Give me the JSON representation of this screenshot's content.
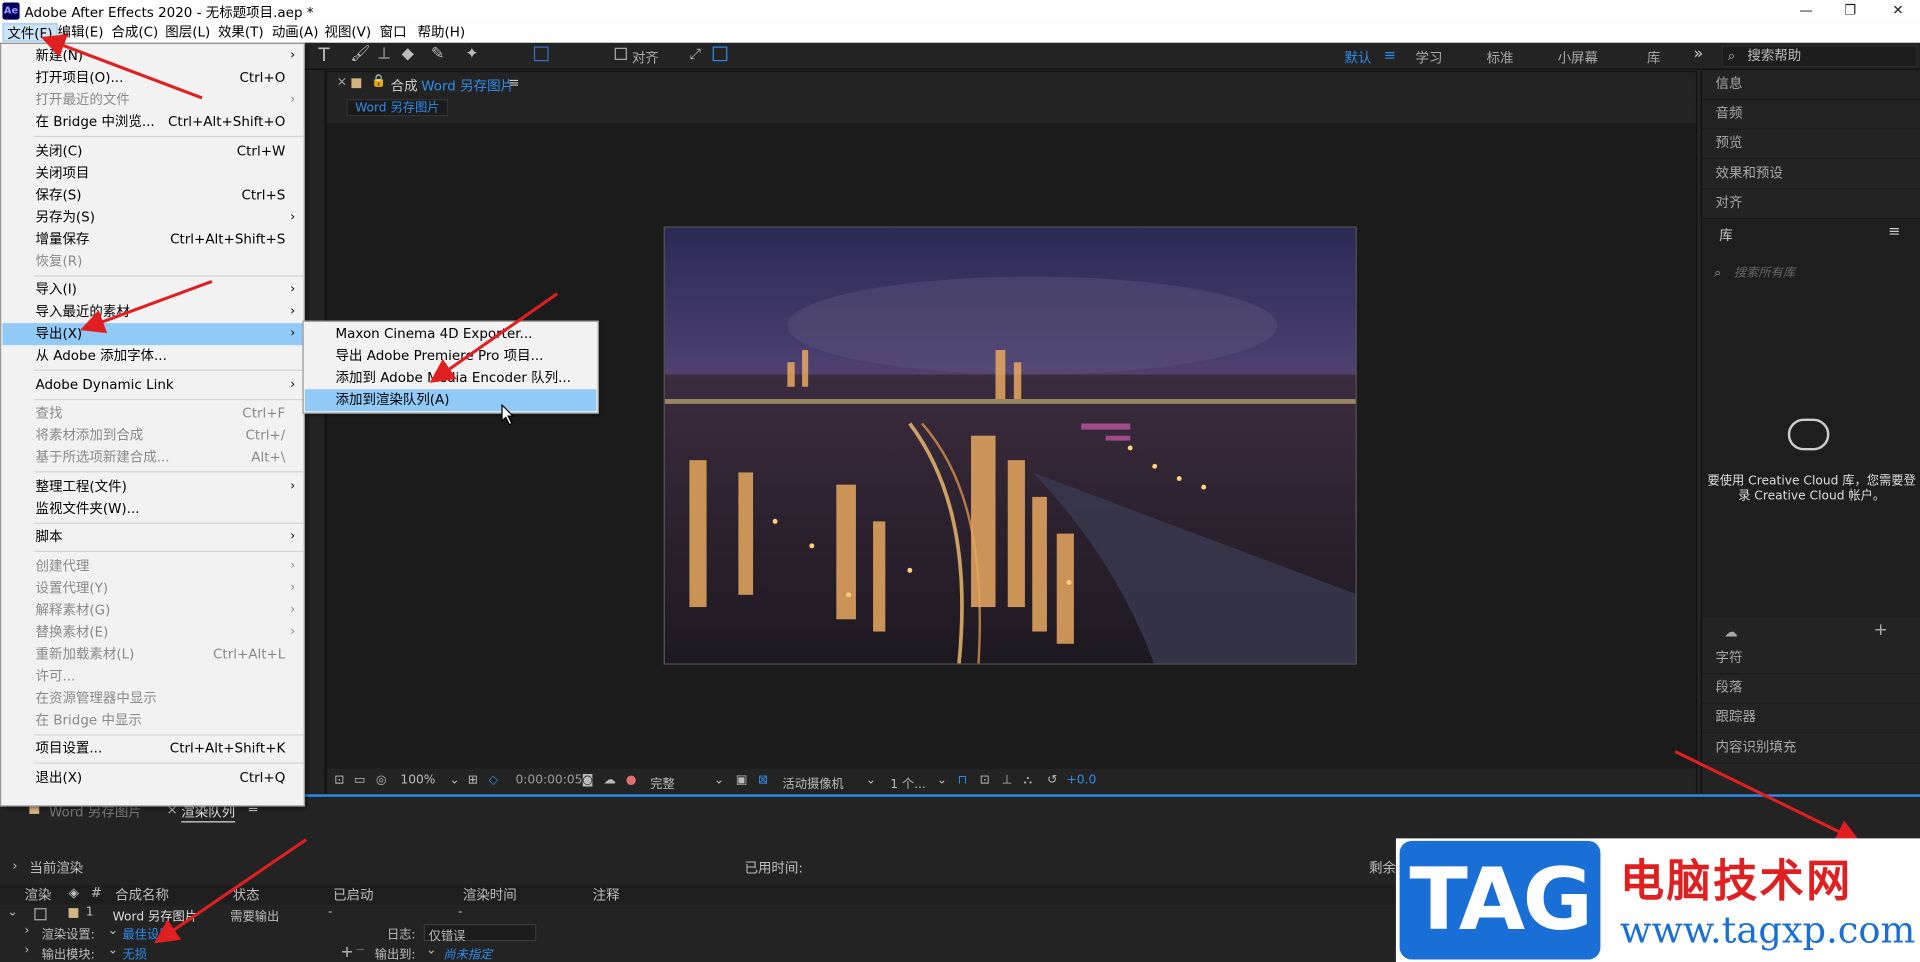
{
  "window": {
    "app_logo": "Ae",
    "title": "Adobe After Effects 2020 - 无标题项目.aep *",
    "minimize": "—",
    "maximize": "❐",
    "close": "✕"
  },
  "menubar": [
    "文件(F)",
    "编辑(E)",
    "合成(C)",
    "图层(L)",
    "效果(T)",
    "动画(A)",
    "视图(V)",
    "窗口",
    "帮助(H)"
  ],
  "toolbar": {
    "align_label": "对齐",
    "workspaces": [
      "默认",
      "学习",
      "标准",
      "小屏幕",
      "库"
    ],
    "search_help": "搜索帮助"
  },
  "comp": {
    "header_prefix": "合成",
    "name": "Word 另存图片",
    "tab": "Word 另存图片"
  },
  "viewer_bar": {
    "zoom": "100%",
    "timecode": "0:00:00:05",
    "resolution": "完整",
    "camera": "活动摄像机",
    "views": "1 个...",
    "exposure": "+0.0"
  },
  "right_panel": {
    "top_items": [
      "信息",
      "音频",
      "预览",
      "效果和预设",
      "对齐"
    ],
    "library_title": "库",
    "library_search": "搜索所有库",
    "cc_message": "要使用 Creative Cloud 库，您需要登录 Creative Cloud 帐户。",
    "bottom_items": [
      "字符",
      "段落",
      "跟踪器",
      "内容识别填充"
    ]
  },
  "file_menu": {
    "items": [
      {
        "label": "新建(N)",
        "shortcut": "",
        "submenu": true,
        "disabled": false
      },
      {
        "label": "打开项目(O)...",
        "shortcut": "Ctrl+O",
        "submenu": false,
        "disabled": false
      },
      {
        "label": "打开最近的文件",
        "shortcut": "",
        "submenu": true,
        "disabled": true
      },
      {
        "label": "在 Bridge 中浏览...",
        "shortcut": "Ctrl+Alt+Shift+O",
        "submenu": false,
        "disabled": false
      },
      {
        "label": "关闭(C)",
        "shortcut": "Ctrl+W",
        "submenu": false,
        "disabled": false
      },
      {
        "label": "关闭项目",
        "shortcut": "",
        "submenu": false,
        "disabled": false
      },
      {
        "label": "保存(S)",
        "shortcut": "Ctrl+S",
        "submenu": false,
        "disabled": false
      },
      {
        "label": "另存为(S)",
        "shortcut": "",
        "submenu": true,
        "disabled": false
      },
      {
        "label": "增量保存",
        "shortcut": "Ctrl+Alt+Shift+S",
        "submenu": false,
        "disabled": false
      },
      {
        "label": "恢复(R)",
        "shortcut": "",
        "submenu": false,
        "disabled": true
      },
      {
        "label": "导入(I)",
        "shortcut": "",
        "submenu": true,
        "disabled": false
      },
      {
        "label": "导入最近的素材",
        "shortcut": "",
        "submenu": true,
        "disabled": false
      },
      {
        "label": "导出(X)",
        "shortcut": "",
        "submenu": true,
        "disabled": false
      },
      {
        "label": "从 Adobe 添加字体...",
        "shortcut": "",
        "submenu": false,
        "disabled": false
      },
      {
        "label": "Adobe Dynamic Link",
        "shortcut": "",
        "submenu": true,
        "disabled": false
      },
      {
        "label": "查找",
        "shortcut": "Ctrl+F",
        "submenu": false,
        "disabled": true
      },
      {
        "label": "将素材添加到合成",
        "shortcut": "Ctrl+/",
        "submenu": false,
        "disabled": true
      },
      {
        "label": "基于所选项新建合成...",
        "shortcut": "Alt+\\",
        "submenu": false,
        "disabled": true
      },
      {
        "label": "整理工程(文件)",
        "shortcut": "",
        "submenu": true,
        "disabled": false
      },
      {
        "label": "监视文件夹(W)...",
        "shortcut": "",
        "submenu": false,
        "disabled": false
      },
      {
        "label": "脚本",
        "shortcut": "",
        "submenu": true,
        "disabled": false
      },
      {
        "label": "创建代理",
        "shortcut": "",
        "submenu": true,
        "disabled": true
      },
      {
        "label": "设置代理(Y)",
        "shortcut": "",
        "submenu": true,
        "disabled": true
      },
      {
        "label": "解释素材(G)",
        "shortcut": "",
        "submenu": true,
        "disabled": true
      },
      {
        "label": "替换素材(E)",
        "shortcut": "",
        "submenu": true,
        "disabled": true
      },
      {
        "label": "重新加载素材(L)",
        "shortcut": "Ctrl+Alt+L",
        "submenu": false,
        "disabled": true
      },
      {
        "label": "许可...",
        "shortcut": "",
        "submenu": false,
        "disabled": true
      },
      {
        "label": "在资源管理器中显示",
        "shortcut": "",
        "submenu": false,
        "disabled": true
      },
      {
        "label": "在 Bridge 中显示",
        "shortcut": "",
        "submenu": false,
        "disabled": true
      },
      {
        "label": "项目设置...",
        "shortcut": "Ctrl+Alt+Shift+K",
        "submenu": false,
        "disabled": false
      },
      {
        "label": "退出(X)",
        "shortcut": "Ctrl+Q",
        "submenu": false,
        "disabled": false
      }
    ]
  },
  "export_submenu": [
    "Maxon Cinema 4D Exporter...",
    "导出 Adobe Premiere Pro 项目...",
    "添加到 Adobe Media Encoder 队列...",
    "添加到渲染队列(A)"
  ],
  "render_queue": {
    "tabs": [
      "Word 另存图片",
      "渲染队列"
    ],
    "current_render": "当前渲染",
    "elapsed": "已用时间:",
    "remaining": "剩余",
    "columns": [
      "渲染",
      "#",
      "合成名称",
      "状态",
      "已启动",
      "渲染时间",
      "注释"
    ],
    "row": {
      "index": "1",
      "name": "Word 另存图片",
      "status": "需要输出",
      "started": "-",
      "render_time": "-"
    },
    "render_settings_label": "渲染设置:",
    "render_settings_value": "最佳设置",
    "log_label": "日志:",
    "log_value": "仅错误",
    "output_module_label": "输出模块:",
    "output_module_value": "无损",
    "output_to_label": "输出到:",
    "output_to_value": "尚未指定"
  },
  "watermark": {
    "tag": "TAG",
    "site_name": "电脑技术网",
    "url": "www.tagxp.com"
  },
  "colors": {
    "accent": "#2d8ceb",
    "menu_highlight": "#91c9f7",
    "annotation_red": "#e02020"
  }
}
